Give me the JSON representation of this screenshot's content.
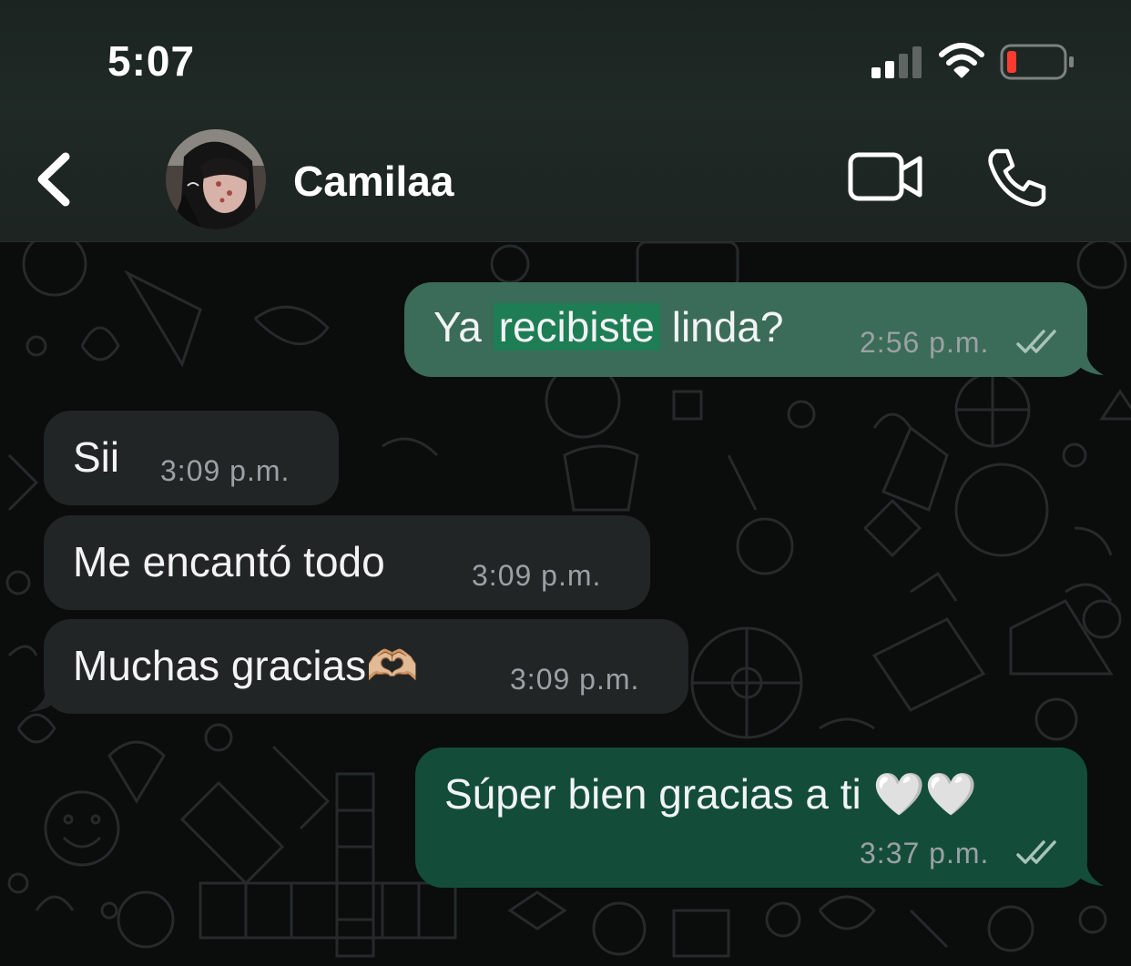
{
  "status_bar": {
    "time": "5:07"
  },
  "header": {
    "contact_name": "Camilaa"
  },
  "messages": [
    {
      "direction": "out",
      "pre": "Ya ",
      "highlight": "recibiste",
      "post": " linda?",
      "time": "2:56",
      "ampm": "p.m."
    },
    {
      "direction": "in",
      "text": "Sii",
      "time": "3:09",
      "ampm": "p.m."
    },
    {
      "direction": "in",
      "text": "Me encantó todo",
      "time": "3:09",
      "ampm": "p.m."
    },
    {
      "direction": "in",
      "text": "Muchas gracias🫶🏼",
      "time": "3:09",
      "ampm": "p.m."
    },
    {
      "direction": "out",
      "text": "Súper bien gracias a ti 🤍🤍",
      "time": "3:37",
      "ampm": "p.m."
    }
  ],
  "icons": {
    "back": "chevron-left-icon",
    "video": "video-camera-icon",
    "call": "phone-icon",
    "read": "double-check-icon"
  },
  "colors": {
    "incoming_bubble": "#222526",
    "outgoing_bubble": "#134d3a",
    "highlight": "#1e7d55"
  }
}
